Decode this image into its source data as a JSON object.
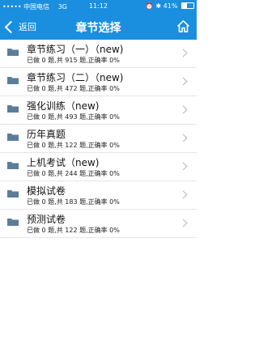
{
  "status_bar": {
    "carrier": "••••• 中国电信",
    "network": "3G",
    "time": "11:12",
    "battery": "41%"
  },
  "nav": {
    "back_label": "返回",
    "title": "章节选择"
  },
  "chapters": [
    {
      "title": "章节练习（一）（new)",
      "info": "已做 0 题,共 915 题,正确率 0%"
    },
    {
      "title": "章节练习（二）（new)",
      "info": "已做 0 题,共 472 题,正确率 0%"
    },
    {
      "title": "强化训练（new)",
      "info": "已做 0 题,共 493 题,正确率 0%"
    },
    {
      "title": "历年真题",
      "info": "已做 0 题,共 122 题,正确率 0%"
    },
    {
      "title": "上机考试（new)",
      "info": "已做 0 题,共 244 题,正确率 0%"
    },
    {
      "title": "模拟试卷",
      "info": "已做 0 题,共 183 题,正确率 0%"
    },
    {
      "title": "预测试卷",
      "info": "已做 0 题,共 122 题,正确率 0%"
    }
  ]
}
